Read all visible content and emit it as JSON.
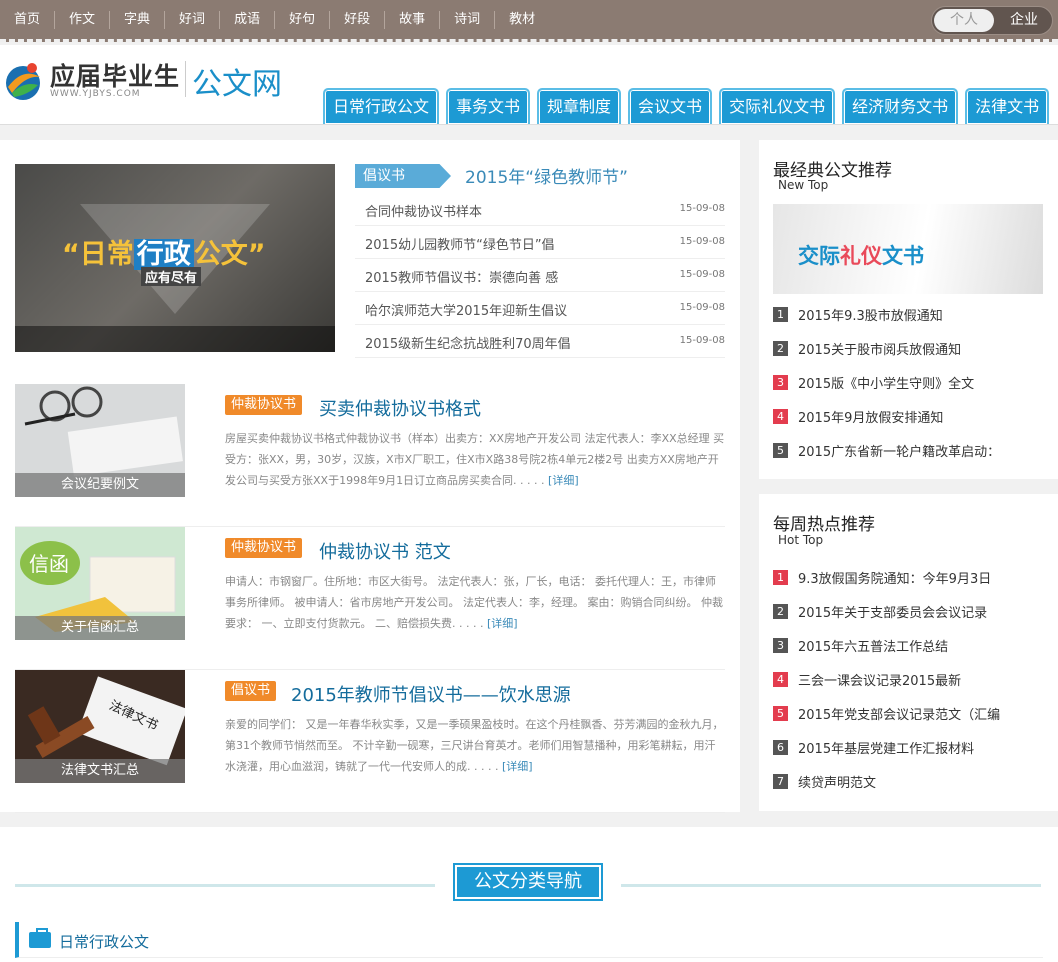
{
  "top_nav": [
    "首页",
    "作文",
    "字典",
    "好词",
    "成语",
    "好句",
    "好段",
    "故事",
    "诗词",
    "教材"
  ],
  "account_toggle": {
    "personal": "个人",
    "enterprise": "企业"
  },
  "logo": {
    "cn": "应届毕业生",
    "en": "WWW.YJBYS.COM",
    "site": "公文网"
  },
  "categories": [
    "日常行政公文",
    "事务文书",
    "规章制度",
    "会议文书",
    "交际礼仪文书",
    "经济财务文书",
    "法律文书"
  ],
  "slider": {
    "headline_pre": "“日常",
    "headline_mid": "行政",
    "headline_post": "公文”",
    "sub": "应有尽有"
  },
  "featured": {
    "tag": "倡议书",
    "title": "2015年“绿色教师节”"
  },
  "feature_list": [
    {
      "title": "合同仲裁协议书样本",
      "date": "15-09-08"
    },
    {
      "title": "2015幼儿园教师节“绿色节日”倡",
      "date": "15-09-08"
    },
    {
      "title": "2015教师节倡议书：崇德向善 感",
      "date": "15-09-08"
    },
    {
      "title": "哈尔滨师范大学2015年迎新生倡议",
      "date": "15-09-08"
    },
    {
      "title": "2015级新生纪念抗战胜利70周年倡",
      "date": "15-09-08"
    }
  ],
  "articles": [
    {
      "caption": "会议纪要例文",
      "tag": "仲裁协议书",
      "title": "买卖仲裁协议书格式",
      "text": "房屋买卖仲裁协议书格式仲裁协议书（样本）出卖方：XX房地产开发公司 法定代表人：李XX总经理 买受方：张XX，男，30岁，汉族，X市X厂职工，住X市X路38号院2栋4单元2楼2号 出卖方XX房地产开发公司与买受方张XX于1998年9月1日订立商品房买卖合同. . . . . ",
      "more": "[详细]"
    },
    {
      "caption": "关于信函汇总",
      "tag": "仲裁协议书",
      "title": "仲裁协议书 范文",
      "text": "申请人：市钢窗厂。住所地：市区大街号。 法定代表人：张，厂长，电话： 委托代理人：王，市律师事务所律师。 被申请人：省市房地产开发公司。 法定代表人：李，经理。 案由：购销合同纠纷。 仲裁要求： 一、立即支付货款元。 二、赔偿损失费. . . . . ",
      "more": "[详细]"
    },
    {
      "caption": "法律文书汇总",
      "tag": "倡议书",
      "title": "2015年教师节倡议书——饮水思源",
      "text": "亲爱的同学们： 又是一年春华秋实季，又是一季硕果盈枝时。在这个丹桂飘香、芬芳满园的金秋九月，第31个教师节悄然而至。 不计辛勤一砚寒，三尺讲台育英才。老师们用智慧播种，用彩笔耕耘，用汗水浇灌，用心血滋润，铸就了一代一代安师人的成. . . . . ",
      "more": "[详细]"
    }
  ],
  "classic": {
    "heading": "最经典公文推荐",
    "sub": "New Top",
    "banner_pre": "交际",
    "banner_red": "礼仪",
    "banner_post": "文书",
    "items": [
      "2015年9.3股市放假通知",
      "2015关于股市阅兵放假通知",
      "2015版《中小学生守则》全文",
      "2015年9月放假安排通知",
      "2015广东省新一轮户籍改革启动："
    ]
  },
  "hot": {
    "heading": "每周热点推荐",
    "sub": "Hot Top",
    "items": [
      "9.3放假国务院通知：今年9月3日",
      "2015年关于支部委员会会议记录",
      "2015年六五普法工作总结",
      "三会一课会议记录2015最新",
      "2015年党支部会议记录范文（汇编",
      "2015年基层党建工作汇报材料",
      "续贷声明范文"
    ]
  },
  "nav_section": {
    "title": "公文分类导航",
    "first_category": "日常行政公文"
  }
}
